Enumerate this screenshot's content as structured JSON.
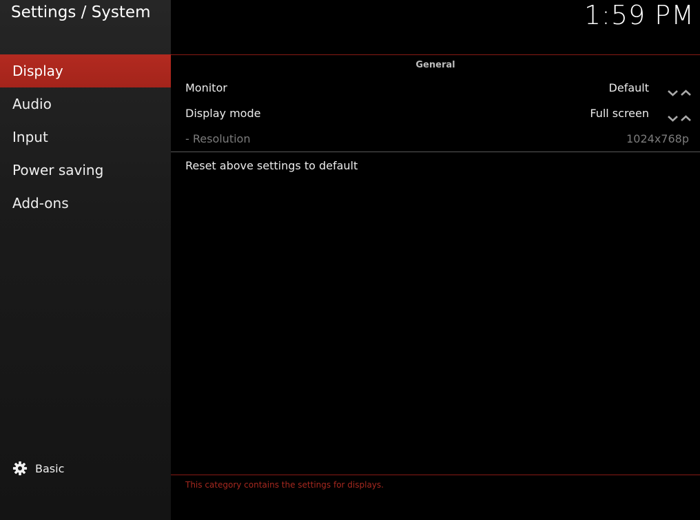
{
  "header": {
    "title": "Settings / System",
    "clock": "1:59 PM"
  },
  "sidebar": {
    "items": [
      {
        "label": "Display",
        "active": true
      },
      {
        "label": "Audio",
        "active": false
      },
      {
        "label": "Input",
        "active": false
      },
      {
        "label": "Power saving",
        "active": false
      },
      {
        "label": "Add-ons",
        "active": false
      }
    ],
    "level": {
      "icon": "gear-icon",
      "label": "Basic"
    }
  },
  "main": {
    "group_header": "General",
    "settings": [
      {
        "label": "Monitor",
        "value": "Default",
        "spinner": true,
        "enabled": true
      },
      {
        "label": "Display mode",
        "value": "Full screen",
        "spinner": true,
        "enabled": true
      },
      {
        "label": "- Resolution",
        "value": "1024x768p",
        "spinner": false,
        "enabled": false
      }
    ],
    "reset_label": "Reset above settings to default"
  },
  "footer": {
    "description": "This category contains the settings for displays."
  },
  "colors": {
    "accent": "#a3241b",
    "accent_line": "#8a1a14",
    "footer_text": "#a6281f",
    "disabled_text": "#7c7c7c"
  }
}
